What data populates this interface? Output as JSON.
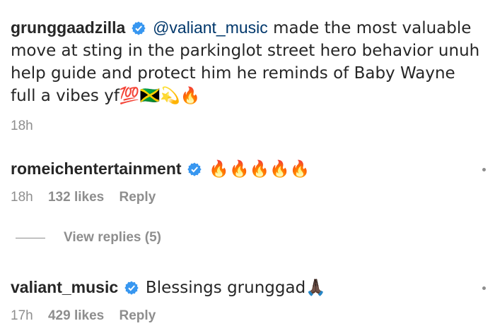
{
  "comments": [
    {
      "username": "grunggaadzilla",
      "mention": "@valiant_music",
      "text": " made the most valuable move at sting in the parkinglot street hero behavior unuh help guide and protect him he reminds of Baby Wayne full a vibes yf💯🇯🇲💫🔥",
      "time": "18h"
    },
    {
      "username": "romeichentertainment",
      "text": "🔥🔥🔥🔥🔥",
      "time": "18h",
      "likes": "132 likes",
      "reply": "Reply"
    },
    {
      "username": "valiant_music",
      "text": "Blessings grunggad🙏🏿",
      "time": "17h",
      "likes": "429 likes",
      "reply": "Reply"
    }
  ],
  "view_replies": "View replies (5)",
  "colors": {
    "verified": "#3897f0",
    "mention": "#00376b",
    "muted": "#8e8e8e"
  },
  "icons": [
    "verified-badge-icon",
    "verified-badge-icon",
    "verified-badge-icon"
  ]
}
